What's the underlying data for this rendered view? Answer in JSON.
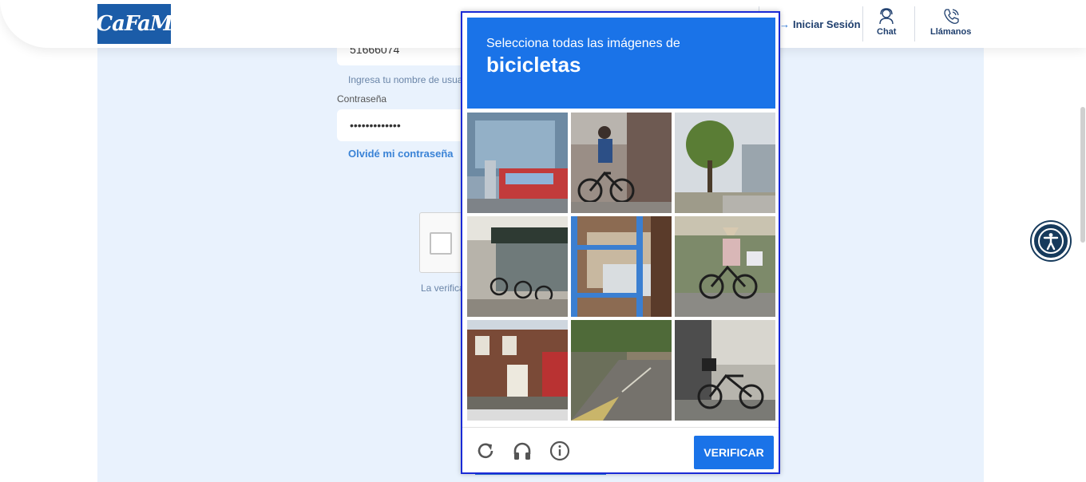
{
  "header": {
    "logo_text": "CaFaM",
    "login_label": "Iniciar Sesión",
    "chat_label": "Chat",
    "call_label": "Llámanos"
  },
  "form": {
    "username_value": "51666074",
    "username_hint": "Ingresa tu nombre de usuario",
    "password_label": "Contraseña",
    "password_value": "•••••••••••••",
    "forgot_link": "Olvidé mi contraseña",
    "recaptcha_note": "La verifica"
  },
  "captcha": {
    "instruction": "Selecciona todas las imágenes de",
    "target": "bicicletas",
    "verify_label": "VERIFICAR",
    "tiles": [
      {
        "scene": "building-bus"
      },
      {
        "scene": "person-bicycle-wall"
      },
      {
        "scene": "street-tree"
      },
      {
        "scene": "parked-bicycles"
      },
      {
        "scene": "blue-railing-car"
      },
      {
        "scene": "person-riding-bicycle"
      },
      {
        "scene": "brick-house"
      },
      {
        "scene": "road-trees"
      },
      {
        "scene": "bicycle-parked-house"
      }
    ]
  },
  "colors": {
    "captcha_blue": "#1a73e8",
    "brand_blue": "#1b5ca8",
    "panel_bg": "#e9f2fd"
  }
}
